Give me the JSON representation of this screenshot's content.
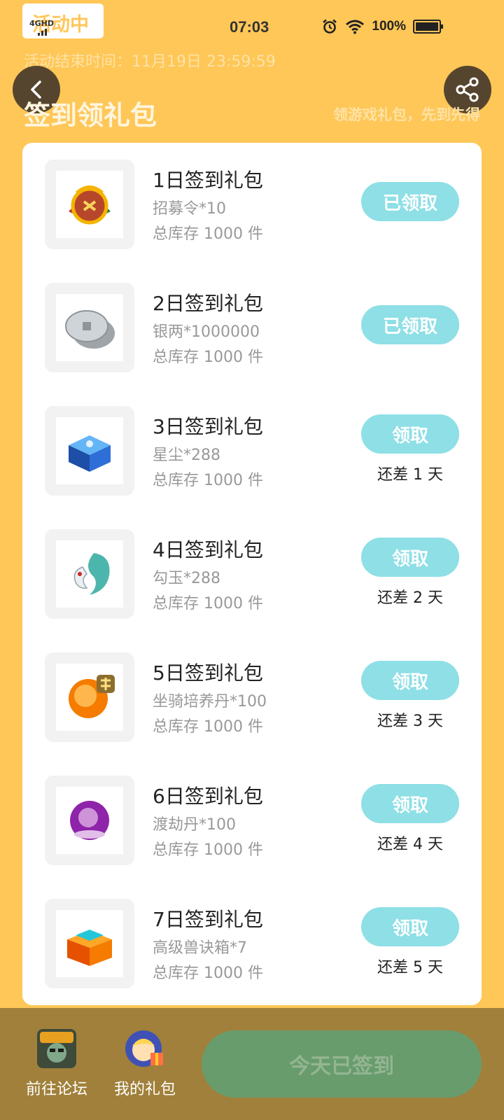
{
  "status_bar": {
    "badge": "活动中",
    "network": "4GHD",
    "time": "07:03",
    "battery": "100%"
  },
  "header": {
    "end_time": "活动结束时间：11月19日 23:59:59",
    "title": "签到领礼包",
    "subtitle": "领游戏礼包，先到先得"
  },
  "gifts": [
    {
      "title": "1日签到礼包",
      "desc": "招募令*10",
      "stock": "总库存 1000 件",
      "button": "已领取",
      "days_left": ""
    },
    {
      "title": "2日签到礼包",
      "desc": "银两*1000000",
      "stock": "总库存 1000 件",
      "button": "已领取",
      "days_left": ""
    },
    {
      "title": "3日签到礼包",
      "desc": "星尘*288",
      "stock": "总库存 1000 件",
      "button": "领取",
      "days_left": "还差 1 天"
    },
    {
      "title": "4日签到礼包",
      "desc": "勾玉*288",
      "stock": "总库存 1000 件",
      "button": "领取",
      "days_left": "还差 2 天"
    },
    {
      "title": "5日签到礼包",
      "desc": "坐骑培养丹*100",
      "stock": "总库存 1000 件",
      "button": "领取",
      "days_left": "还差 3 天"
    },
    {
      "title": "6日签到礼包",
      "desc": "渡劫丹*100",
      "stock": "总库存 1000 件",
      "button": "领取",
      "days_left": "还差 4 天"
    },
    {
      "title": "7日签到礼包",
      "desc": "高级兽诀箱*7",
      "stock": "总库存 1000 件",
      "button": "领取",
      "days_left": "还差 5 天"
    }
  ],
  "bottom": {
    "forum": "前往论坛",
    "my_gifts": "我的礼包",
    "checkin": "今天已签到"
  },
  "colors": {
    "background": "#FEC757",
    "button": "#8EDFE6",
    "bottom_bar": "#A0803A",
    "checkin_button": "#689C6D"
  }
}
